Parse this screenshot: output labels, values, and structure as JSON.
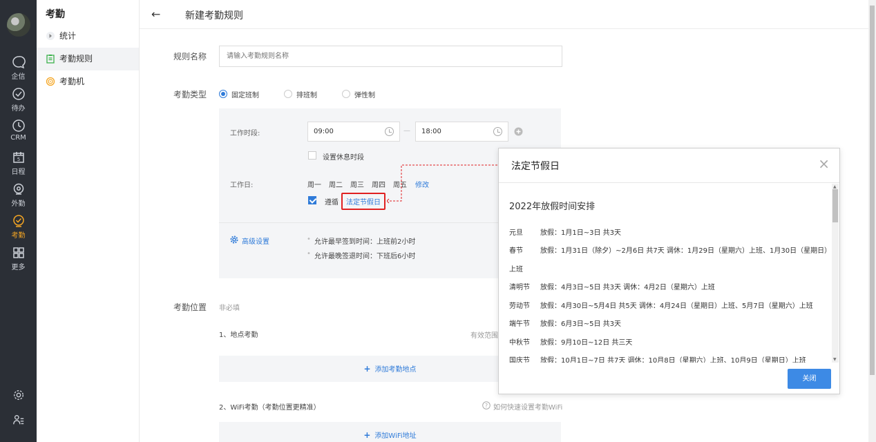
{
  "rail": {
    "items": [
      {
        "label": "企信",
        "icon": "chat-icon"
      },
      {
        "label": "待办",
        "icon": "check-circle-icon"
      },
      {
        "label": "CRM",
        "icon": "clock-icon"
      },
      {
        "label": "日程",
        "icon": "calendar-icon"
      },
      {
        "label": "外勤",
        "icon": "location-icon"
      },
      {
        "label": "考勤",
        "icon": "attendance-icon"
      },
      {
        "label": "更多",
        "icon": "grid-icon"
      }
    ],
    "active_color": "#f5a623"
  },
  "sidebar": {
    "title": "考勤",
    "items": [
      {
        "label": "统计"
      },
      {
        "label": "考勤规则"
      },
      {
        "label": "考勤机"
      }
    ]
  },
  "header": {
    "back": "←",
    "title": "新建考勤规则"
  },
  "form": {
    "rule_name_label": "规则名称",
    "rule_name_placeholder": "请输入考勤规则名称",
    "type_label": "考勤类型",
    "types": [
      "固定班制",
      "排班制",
      "弹性制"
    ],
    "work_period_label": "工作时段:",
    "start_time": "09:00",
    "end_time": "18:00",
    "time_sep": "—",
    "rest_label": "设置休息时段",
    "workday_label": "工作日:",
    "days": [
      "周一",
      "周二",
      "周三",
      "周四",
      "周五"
    ],
    "modify": "修改",
    "follow_label": "遵循",
    "holiday_link": "法定节假日",
    "advanced": "高级设置",
    "rule1": "允许最早签到时间：上班前2小时",
    "rule2": "允许最晚签退时间：下班后6小时",
    "location_label": "考勤位置",
    "location_optional": "非必填",
    "loc1": "1、地点考勤",
    "loc1_right": "有效范围",
    "add_location": "添加考勤地点",
    "loc2": "2、WiFi考勤（考勤位置更精准）",
    "wifi_help": "如何快速设置考勤WiFi",
    "add_wifi": "添加WiFi地址",
    "accent": "#2f7bd9"
  },
  "modal": {
    "title": "法定节假日",
    "close": "×",
    "heading": "2022年放假时间安排",
    "holidays": [
      {
        "name": "元旦",
        "text": "放假：1月1日~3日 共3天"
      },
      {
        "name": "春节",
        "text": "放假：1月31日（除夕）~2月6日 共7天 调休：1月29日（星期六）上班、1月30日（星期日）"
      },
      {
        "name": "",
        "text": "上班"
      },
      {
        "name": "清明节",
        "text": "放假：4月3日~5日 共3天 调休：4月2日（星期六）上班"
      },
      {
        "name": "劳动节",
        "text": "放假：4月30日~5月4日 共5天 调休：4月24日（星期日）上班、5月7日（星期六）上班"
      },
      {
        "name": "端午节",
        "text": "放假：6月3日~5日 共3天"
      },
      {
        "name": "中秋节",
        "text": "放假：9月10日~12日 共三天"
      },
      {
        "name": "国庆节",
        "text": "放假：10月1日~7日 共7天 调休：10月8日（星期六）上班、10月9日（星期日）上班"
      }
    ],
    "close_button": "关闭",
    "annotation_color": "#e02020"
  }
}
